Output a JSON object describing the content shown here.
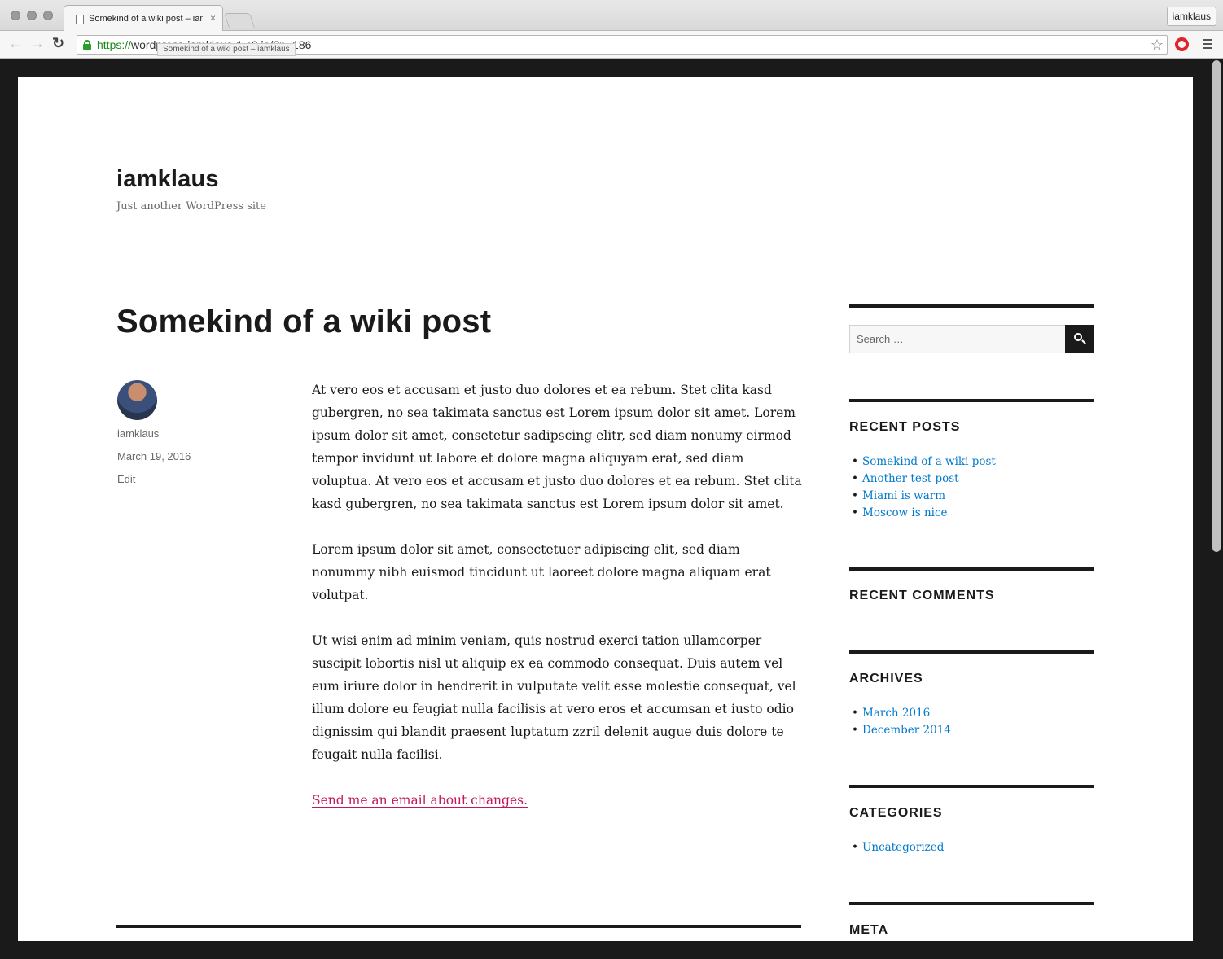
{
  "browser": {
    "tab_title": "Somekind of a wiki post – iamklaus",
    "tab_close": "×",
    "profile_name": "iamklaus",
    "url_scheme": "https://",
    "url_rest": "wordpress-iamklaus-1.c9.io/?p=186",
    "url_tooltip": "Somekind of a wiki post – iamklaus",
    "back_glyph": "←",
    "forward_glyph": "→",
    "reload_glyph": "↻",
    "star_glyph": "☆"
  },
  "site": {
    "title": "iamklaus",
    "tagline": "Just another WordPress site"
  },
  "post": {
    "title": "Somekind of a wiki post",
    "author": "iamklaus",
    "date": "March 19, 2016",
    "edit_label": "Edit",
    "paragraphs": [
      "At vero eos et accusam et justo duo dolores et ea rebum. Stet clita kasd gubergren, no sea takimata sanctus est Lorem ipsum dolor sit amet. Lorem ipsum dolor sit amet, consetetur sadipscing elitr, sed diam nonumy eirmod tempor invidunt ut labore et dolore magna aliquyam erat, sed diam voluptua. At vero eos et accusam et justo duo dolores et ea rebum. Stet clita kasd gubergren, no sea takimata sanctus est Lorem ipsum dolor sit amet.",
      "Lorem ipsum dolor sit amet, consectetuer adipiscing elit, sed diam nonummy nibh euismod tincidunt ut laoreet dolore magna aliquam erat volutpat.",
      "Ut wisi enim ad minim veniam, quis nostrud exerci tation ullamcorper suscipit lobortis nisl ut aliquip ex ea commodo consequat. Duis autem vel eum iriure dolor in hendrerit in vulputate velit esse molestie consequat, vel illum dolore eu feugiat nulla facilisis at vero eros et accumsan et iusto odio dignissim qui blandit praesent luptatum zzril delenit augue duis dolore te feugait nulla facilisi."
    ],
    "email_link": "Send me an email about changes."
  },
  "sidebar": {
    "search_placeholder": "Search …",
    "recent_posts": {
      "title": "RECENT POSTS",
      "items": [
        "Somekind of a wiki post",
        "Another test post",
        "Miami is warm",
        "Moscow is nice"
      ]
    },
    "recent_comments": {
      "title": "RECENT COMMENTS"
    },
    "archives": {
      "title": "ARCHIVES",
      "items": [
        "March 2016",
        "December 2014"
      ]
    },
    "categories": {
      "title": "CATEGORIES",
      "items": [
        "Uncategorized"
      ]
    },
    "meta": {
      "title": "META"
    }
  },
  "colors": {
    "link": "#007acc",
    "post_link": "#c2185b",
    "text": "#1a1a1a",
    "muted": "#686868"
  }
}
